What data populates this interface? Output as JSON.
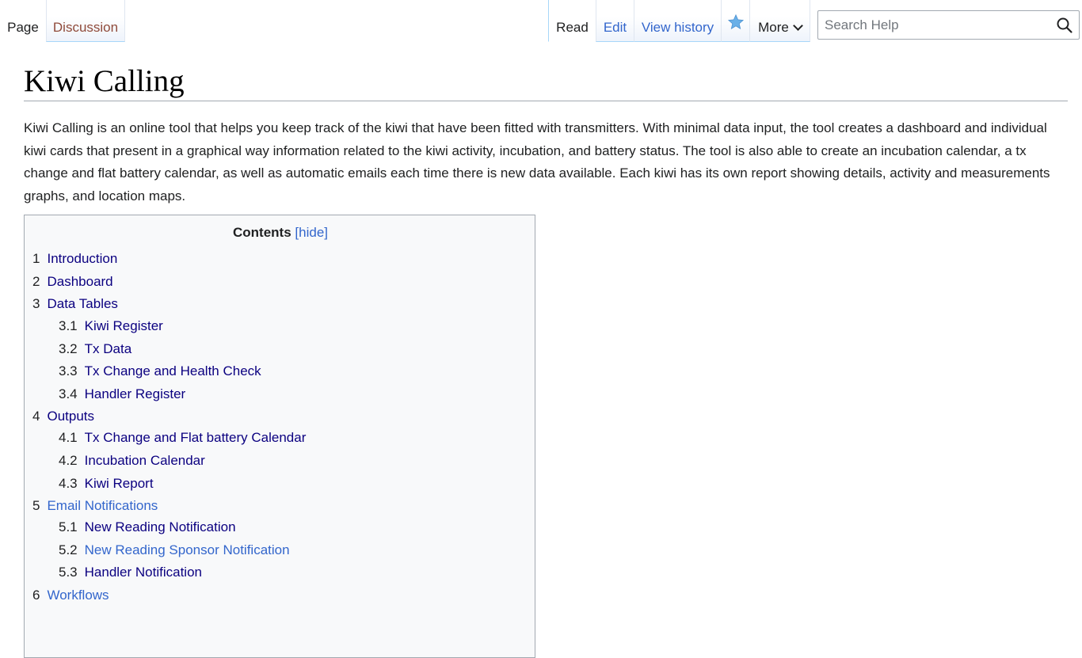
{
  "tabs": {
    "page": "Page",
    "discussion": "Discussion",
    "read": "Read",
    "edit": "Edit",
    "view_history": "View history",
    "watch_icon": "star-icon",
    "more": "More"
  },
  "search": {
    "placeholder": "Search Help",
    "icon": "search-icon"
  },
  "article": {
    "title": "Kiwi Calling",
    "intro": "Kiwi Calling is an online tool that helps you keep track of the kiwi that have been fitted with transmitters. With minimal data input, the tool creates a dashboard and individual kiwi cards that present in a graphical way information related to the kiwi activity, incubation, and battery status. The tool is also able to create an incubation calendar, a tx change and flat battery calendar, as well as automatic emails each time there is new data available. Each kiwi has its own report showing details, activity and measurements graphs, and location maps."
  },
  "toc": {
    "title": "Contents",
    "toggle_label": "[hide]",
    "items": [
      {
        "num": "1",
        "label": "Introduction"
      },
      {
        "num": "2",
        "label": "Dashboard"
      },
      {
        "num": "3",
        "label": "Data Tables"
      },
      {
        "num": "3.1",
        "label": "Kiwi Register"
      },
      {
        "num": "3.2",
        "label": "Tx Data"
      },
      {
        "num": "3.3",
        "label": "Tx Change and Health Check"
      },
      {
        "num": "3.4",
        "label": "Handler Register"
      },
      {
        "num": "4",
        "label": "Outputs"
      },
      {
        "num": "4.1",
        "label": "Tx Change and Flat battery Calendar"
      },
      {
        "num": "4.2",
        "label": "Incubation Calendar"
      },
      {
        "num": "4.3",
        "label": "Kiwi Report"
      },
      {
        "num": "5",
        "label": "Email Notifications"
      },
      {
        "num": "5.1",
        "label": "New Reading Notification"
      },
      {
        "num": "5.2",
        "label": "New Reading Sponsor Notification"
      },
      {
        "num": "5.3",
        "label": "Handler Notification"
      },
      {
        "num": "6",
        "label": "Workflows"
      }
    ]
  },
  "colors": {
    "link": "#0b0080",
    "link_blue": "#3366cc",
    "new_link": "#8f4a3a",
    "border": "#a2a9b1",
    "toc_bg": "#f8f9fa"
  }
}
